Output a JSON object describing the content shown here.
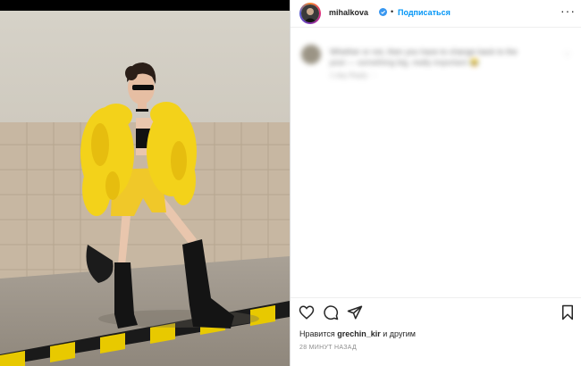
{
  "post": {
    "username": "mihalkova",
    "dot": "•",
    "follow_label": "Подписаться",
    "more_label": "···"
  },
  "comment": {
    "line1": "Whether or not, then you have to change back to the",
    "line2": "post — something big, really important 😂",
    "meta": "1 day   Reply   ···",
    "heart": "♡"
  },
  "likes": {
    "prefix": "Нравится",
    "user": "grechin_kir",
    "suffix": "и другим"
  },
  "timestamp": "28 МИНУТ НАЗАД",
  "icons": {
    "like": "heart-icon",
    "comment": "comment-icon",
    "share": "share-icon",
    "save": "bookmark-icon",
    "more": "more-icon",
    "verified": "verified-badge-icon"
  },
  "colors": {
    "accent": "#0095f6",
    "text": "#262626",
    "muted": "#8e8e8e",
    "jacket": "#f3d21a",
    "stripe_yellow": "#e8c900"
  }
}
